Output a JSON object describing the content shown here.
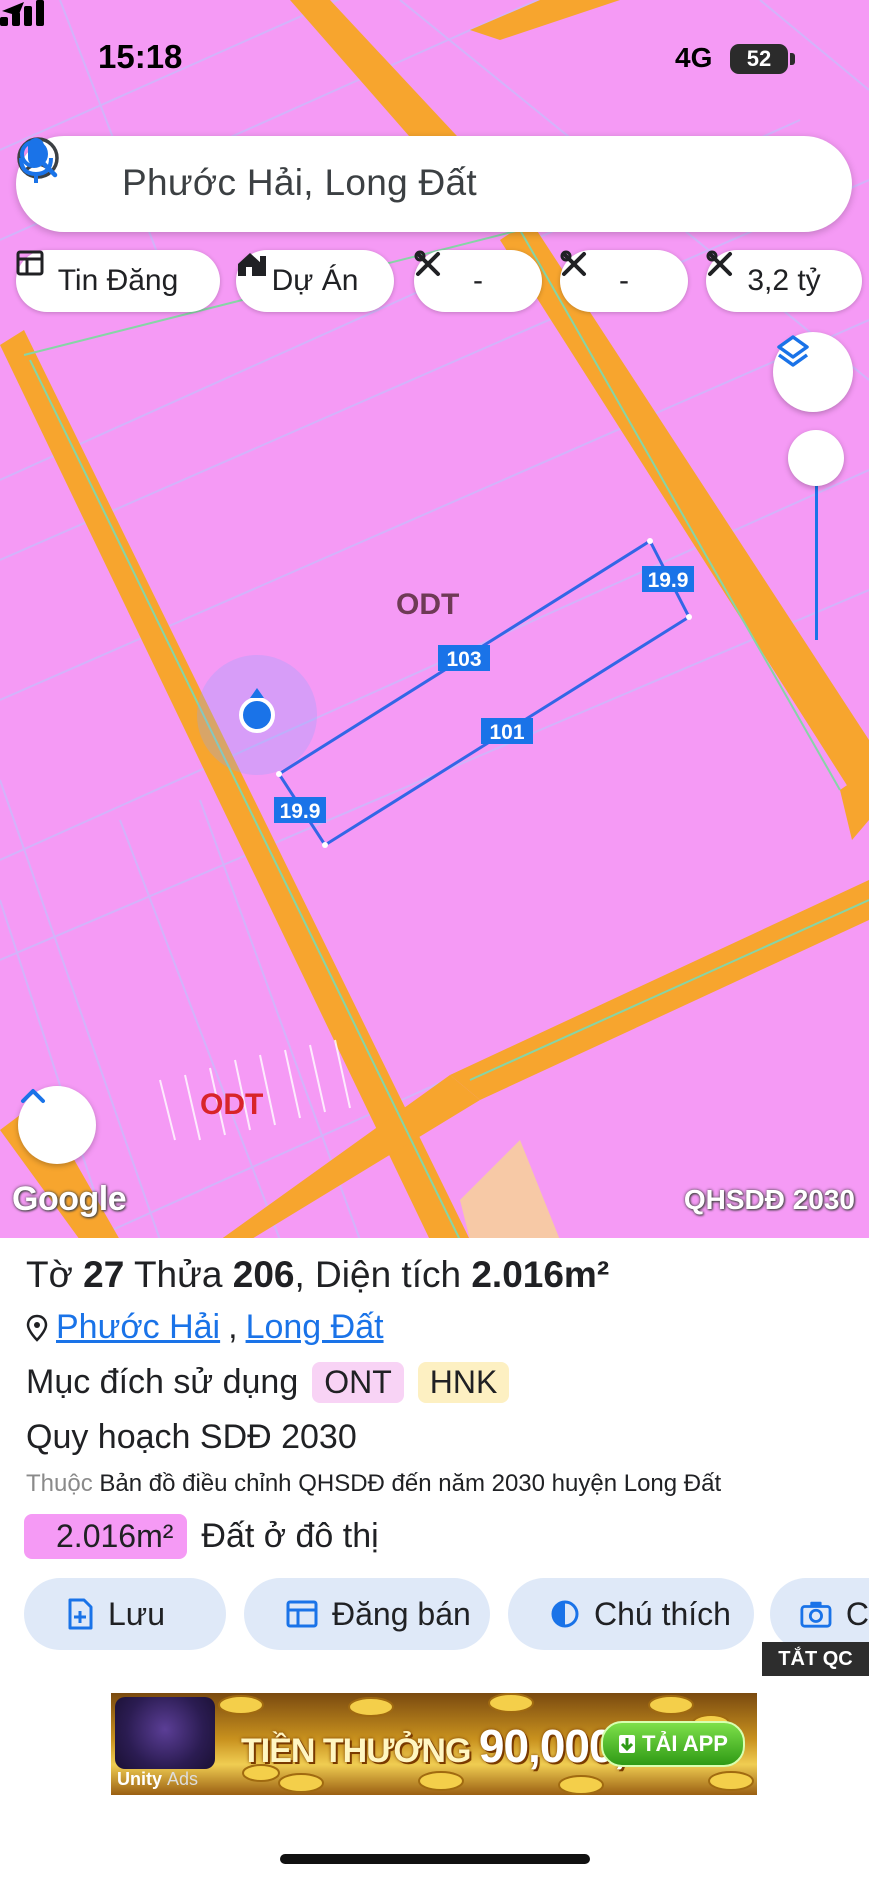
{
  "status_bar": {
    "time": "15:18",
    "network": "4G",
    "battery": "52"
  },
  "search": {
    "query": "Phước Hải, Long Đất"
  },
  "filters": {
    "listings": "Tin Đăng",
    "projects": "Dự Án",
    "filter_a": "-",
    "filter_b": "-",
    "price": "3,2 tỷ"
  },
  "map": {
    "zone_label_1": "ODT",
    "zone_label_2": "ODT",
    "edge_top": "19.9",
    "edge_left": "19.9",
    "edge_upper": "103",
    "edge_lower": "101",
    "google": "Google",
    "source": "QHSDĐ 2030",
    "colors": {
      "residential": "#f59af5",
      "road": "#f7a52e",
      "boundary": "#3366e6"
    }
  },
  "parcel": {
    "sheet_label": "Tờ",
    "sheet_no": "27",
    "plot_label": "Thửa",
    "plot_no": "206",
    "area_label": "Diện tích",
    "area": "2.016m²",
    "ward": "Phước Hải",
    "district": "Long Đất",
    "purpose_label": "Mục đích sử dụng",
    "purpose_tags": [
      "ONT",
      "HNK"
    ],
    "plan_title": "Quy hoạch SDĐ 2030",
    "belongs_prefix": "Thuộc",
    "belongs_text": "Bản đồ điều chỉnh QHSDĐ đến năm 2030 huyện Long Đất",
    "area_badge": "2.016m²",
    "area_type": "Đất ở đô thị"
  },
  "actions": {
    "save": "Lưu",
    "post": "Đăng bán",
    "legend": "Chú thích",
    "camera": "C"
  },
  "ad": {
    "close": "TẮT QC",
    "bonus_label": "TIỀN THƯỞNG",
    "bonus_amount": "90,000,000Đ",
    "cta": "TẢI APP",
    "brand": "Unity",
    "brand_suffix": "Ads"
  }
}
